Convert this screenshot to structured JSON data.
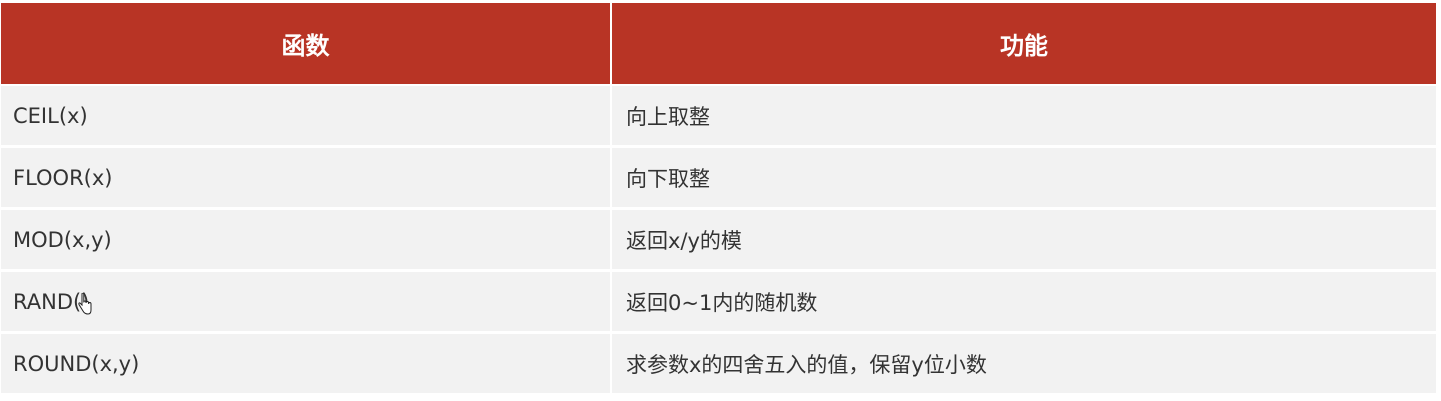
{
  "table": {
    "headers": [
      "函数",
      "功能"
    ],
    "rows": [
      {
        "func": "CEIL(x)",
        "desc": "向上取整"
      },
      {
        "func": "FLOOR(x)",
        "desc": "向下取整"
      },
      {
        "func": "MOD(x,y)",
        "desc": "返回x/y的模"
      },
      {
        "func": "RAND()",
        "desc": "返回0~1内的随机数"
      },
      {
        "func": "ROUND(x,y)",
        "desc": "求参数x的四舍五入的值，保留y位小数"
      }
    ]
  },
  "colors": {
    "header_bg": "#b83425",
    "header_text": "#ffffff",
    "row_bg": "#f2f2f2",
    "row_text": "#333333"
  },
  "icons": {
    "cursor": "mouse-pointer-hand-icon"
  }
}
